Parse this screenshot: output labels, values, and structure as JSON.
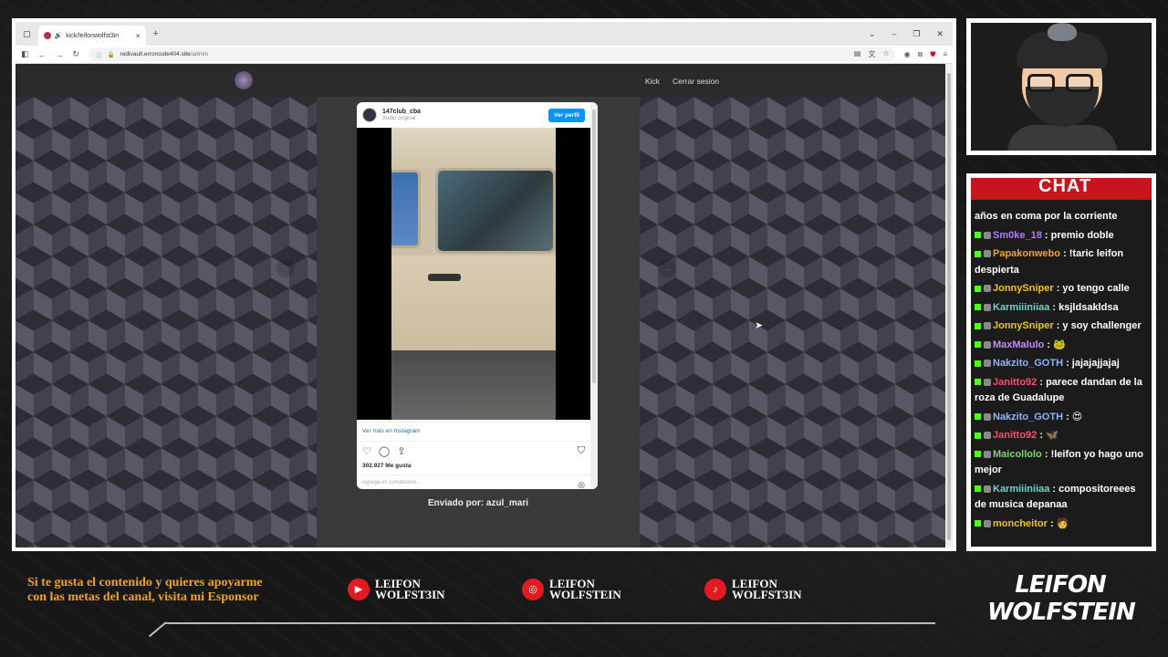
{
  "browser": {
    "tab_title": "kick/leifonwolfst3in",
    "tab_close": "×",
    "new_tab": "+",
    "url_host": "redivault.errorcode404.site",
    "url_path": "/admin"
  },
  "site": {
    "nav_kick": "Kick",
    "nav_logout": "Cerrar sesion",
    "prev_arrow": "←",
    "next_arrow": "→",
    "sent_by": "Enviado por: azul_mari"
  },
  "instagram": {
    "username": "147club_cba",
    "subtitle": "Audio original",
    "view_profile": "Ver perfil",
    "see_more": "Ver más en Instagram",
    "likes": "302.927 Me gusta",
    "comment_placeholder": "Agrega un comentario..."
  },
  "chat": {
    "title": "CHAT",
    "messages": [
      {
        "user": "",
        "text": "años en coma por la corriente",
        "color": "#ffffff"
      },
      {
        "user": "Sm0ke_18",
        "text": ": premio doble",
        "color": "#b57bff"
      },
      {
        "user": "Papakonwebo",
        "text": ": !taric leifon despierta",
        "color": "#f0a31c"
      },
      {
        "user": "JonnySniper",
        "text": ": yo tengo calle",
        "color": "#f0c419"
      },
      {
        "user": "Karmiiiniiaa",
        "text": ": ksjldsakldsa",
        "color": "#6ad6c6"
      },
      {
        "user": "JonnySniper",
        "text": ": y soy challenger",
        "color": "#f0c419"
      },
      {
        "user": "MaxMalulo",
        "text": ": 🐸",
        "color": "#c38cff"
      },
      {
        "user": "Nakzito_GOTH",
        "text": ": jajajajjajaj",
        "color": "#8fb4ff"
      },
      {
        "user": "Janitto92",
        "text": ": parece dandan de la roza de Guadalupe",
        "color": "#ff4d6d"
      },
      {
        "user": "Nakzito_GOTH",
        "text": ": 😍",
        "color": "#8fb4ff"
      },
      {
        "user": "Janitto92",
        "text": ": 🦋",
        "color": "#ff4d6d"
      },
      {
        "user": "Maicollolo",
        "text": ": !leifon yo hago uno mejor",
        "color": "#7dd66a"
      },
      {
        "user": "Karmiiiniiaa",
        "text": ": compositoreees de musica depanaa",
        "color": "#6ad6c6"
      },
      {
        "user": "moncheitor",
        "text": ": 🧑",
        "color": "#f0c419"
      }
    ]
  },
  "footer": {
    "promo": "Si te gusta el contenido y quieres apoyarme con las metas del canal, visita mi Esponsor",
    "youtube_l1": "LEIFON",
    "youtube_l2": "WOLFST3IN",
    "instagram_l1": "LEIFON",
    "instagram_l2": "WOLFSTEIN",
    "tiktok_l1": "LEIFON",
    "tiktok_l2": "WOLFST3IN",
    "brand_l1": "LEIFON",
    "brand_l2": "WOLFSTEIN"
  },
  "colors": {
    "accent": "#c6151c",
    "promo": "#f0a31c",
    "kick_green": "#53fc18"
  }
}
